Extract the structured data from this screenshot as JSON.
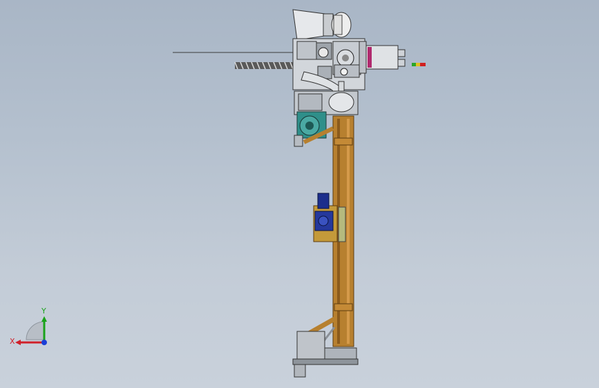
{
  "viewport": {
    "background_top": "#a9b6c6",
    "background_bottom": "#c9d1db"
  },
  "triad": {
    "x_label": "X",
    "y_label": "Y",
    "x_color": "#d0202a",
    "y_color": "#1aa31a",
    "z_color": "#1b3fd6"
  },
  "model": {
    "frame_color": "#b7802f",
    "motor_color": "#1c2e8c",
    "pump_color": "#2f8f8a",
    "steel_color": "#d9dde2"
  }
}
